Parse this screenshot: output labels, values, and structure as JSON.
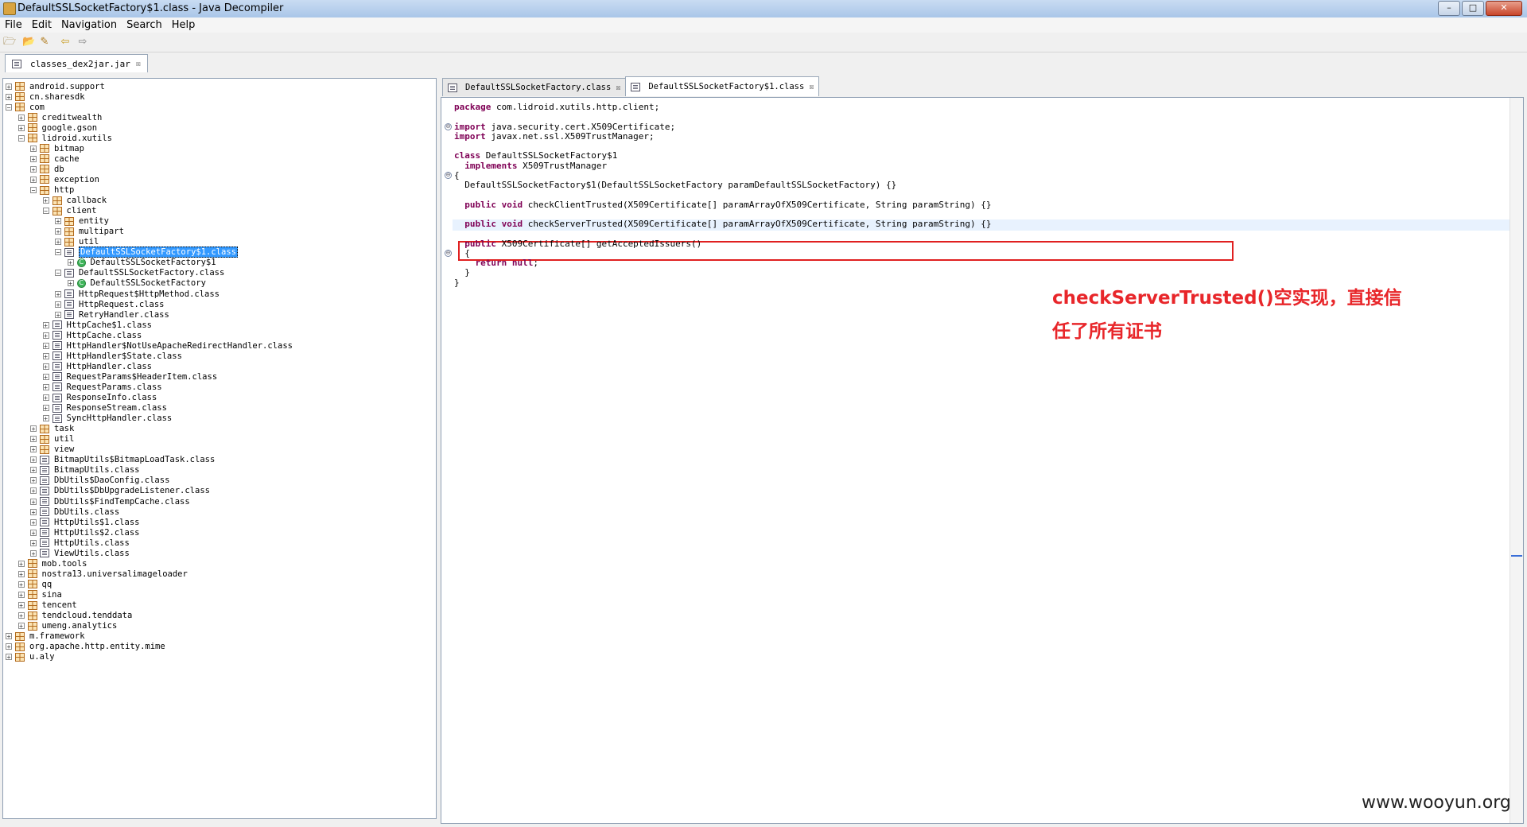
{
  "window": {
    "title": "DefaultSSLSocketFactory$1.class - Java Decompiler",
    "min_glyph": "–",
    "max_glyph": "□",
    "close_glyph": "✕"
  },
  "menu": [
    "File",
    "Edit",
    "Navigation",
    "Search",
    "Help"
  ],
  "toolbar": {
    "open_glyph": "🗁",
    "open_recent_glyph": "📂",
    "save_glyph": "✎",
    "back_glyph": "⇦",
    "forward_glyph": "⇨"
  },
  "left_tab": {
    "label": "classes_dex2jar.jar",
    "close_glyph": "☒"
  },
  "tree": [
    {
      "label": "android.support",
      "icon": "package",
      "expander": "+",
      "depth": 0
    },
    {
      "label": "cn.sharesdk",
      "icon": "package",
      "expander": "+",
      "depth": 0
    },
    {
      "label": "com",
      "icon": "package",
      "expander": "−",
      "depth": 0
    },
    {
      "label": "creditwealth",
      "icon": "package",
      "expander": "+",
      "depth": 1
    },
    {
      "label": "google.gson",
      "icon": "package",
      "expander": "+",
      "depth": 1
    },
    {
      "label": "lidroid.xutils",
      "icon": "package",
      "expander": "−",
      "depth": 1
    },
    {
      "label": "bitmap",
      "icon": "package",
      "expander": "+",
      "depth": 2
    },
    {
      "label": "cache",
      "icon": "package",
      "expander": "+",
      "depth": 2
    },
    {
      "label": "db",
      "icon": "package",
      "expander": "+",
      "depth": 2
    },
    {
      "label": "exception",
      "icon": "package",
      "expander": "+",
      "depth": 2
    },
    {
      "label": "http",
      "icon": "package",
      "expander": "−",
      "depth": 2
    },
    {
      "label": "callback",
      "icon": "package",
      "expander": "+",
      "depth": 3
    },
    {
      "label": "client",
      "icon": "package",
      "expander": "−",
      "depth": 3
    },
    {
      "label": "entity",
      "icon": "package",
      "expander": "+",
      "depth": 4
    },
    {
      "label": "multipart",
      "icon": "package",
      "expander": "+",
      "depth": 4
    },
    {
      "label": "util",
      "icon": "package",
      "expander": "+",
      "depth": 4
    },
    {
      "label": "DefaultSSLSocketFactory$1.class",
      "icon": "class",
      "expander": "−",
      "depth": 4,
      "selected": true
    },
    {
      "label": "DefaultSSLSocketFactory$1",
      "icon": "type",
      "expander": "+",
      "depth": 5
    },
    {
      "label": "DefaultSSLSocketFactory.class",
      "icon": "class",
      "expander": "−",
      "depth": 4
    },
    {
      "label": "DefaultSSLSocketFactory",
      "icon": "type",
      "expander": "+",
      "depth": 5
    },
    {
      "label": "HttpRequest$HttpMethod.class",
      "icon": "class",
      "expander": "+",
      "depth": 4
    },
    {
      "label": "HttpRequest.class",
      "icon": "class",
      "expander": "+",
      "depth": 4
    },
    {
      "label": "RetryHandler.class",
      "icon": "class",
      "expander": "+",
      "depth": 4
    },
    {
      "label": "HttpCache$1.class",
      "icon": "class",
      "expander": "+",
      "depth": 3
    },
    {
      "label": "HttpCache.class",
      "icon": "class",
      "expander": "+",
      "depth": 3
    },
    {
      "label": "HttpHandler$NotUseApacheRedirectHandler.class",
      "icon": "class",
      "expander": "+",
      "depth": 3
    },
    {
      "label": "HttpHandler$State.class",
      "icon": "class",
      "expander": "+",
      "depth": 3
    },
    {
      "label": "HttpHandler.class",
      "icon": "class",
      "expander": "+",
      "depth": 3
    },
    {
      "label": "RequestParams$HeaderItem.class",
      "icon": "class",
      "expander": "+",
      "depth": 3
    },
    {
      "label": "RequestParams.class",
      "icon": "class",
      "expander": "+",
      "depth": 3
    },
    {
      "label": "ResponseInfo.class",
      "icon": "class",
      "expander": "+",
      "depth": 3
    },
    {
      "label": "ResponseStream.class",
      "icon": "class",
      "expander": "+",
      "depth": 3
    },
    {
      "label": "SyncHttpHandler.class",
      "icon": "class",
      "expander": "+",
      "depth": 3
    },
    {
      "label": "task",
      "icon": "package",
      "expander": "+",
      "depth": 2
    },
    {
      "label": "util",
      "icon": "package",
      "expander": "+",
      "depth": 2
    },
    {
      "label": "view",
      "icon": "package",
      "expander": "+",
      "depth": 2
    },
    {
      "label": "BitmapUtils$BitmapLoadTask.class",
      "icon": "class",
      "expander": "+",
      "depth": 2
    },
    {
      "label": "BitmapUtils.class",
      "icon": "class",
      "expander": "+",
      "depth": 2
    },
    {
      "label": "DbUtils$DaoConfig.class",
      "icon": "class",
      "expander": "+",
      "depth": 2
    },
    {
      "label": "DbUtils$DbUpgradeListener.class",
      "icon": "class",
      "expander": "+",
      "depth": 2
    },
    {
      "label": "DbUtils$FindTempCache.class",
      "icon": "class",
      "expander": "+",
      "depth": 2
    },
    {
      "label": "DbUtils.class",
      "icon": "class",
      "expander": "+",
      "depth": 2
    },
    {
      "label": "HttpUtils$1.class",
      "icon": "class",
      "expander": "+",
      "depth": 2
    },
    {
      "label": "HttpUtils$2.class",
      "icon": "class",
      "expander": "+",
      "depth": 2
    },
    {
      "label": "HttpUtils.class",
      "icon": "class",
      "expander": "+",
      "depth": 2
    },
    {
      "label": "ViewUtils.class",
      "icon": "class",
      "expander": "+",
      "depth": 2
    },
    {
      "label": "mob.tools",
      "icon": "package",
      "expander": "+",
      "depth": 1
    },
    {
      "label": "nostra13.universalimageloader",
      "icon": "package",
      "expander": "+",
      "depth": 1
    },
    {
      "label": "qq",
      "icon": "package",
      "expander": "+",
      "depth": 1
    },
    {
      "label": "sina",
      "icon": "package",
      "expander": "+",
      "depth": 1
    },
    {
      "label": "tencent",
      "icon": "package",
      "expander": "+",
      "depth": 1
    },
    {
      "label": "tendcloud.tenddata",
      "icon": "package",
      "expander": "+",
      "depth": 1
    },
    {
      "label": "umeng.analytics",
      "icon": "package",
      "expander": "+",
      "depth": 1
    },
    {
      "label": "m.framework",
      "icon": "package",
      "expander": "+",
      "depth": 0
    },
    {
      "label": "org.apache.http.entity.mime",
      "icon": "package",
      "expander": "+",
      "depth": 0
    },
    {
      "label": "u.aly",
      "icon": "package",
      "expander": "+",
      "depth": 0
    }
  ],
  "editor_tabs": [
    {
      "label": "DefaultSSLSocketFactory.class",
      "active": false,
      "close_glyph": "☒"
    },
    {
      "label": "DefaultSSLSocketFactory$1.class",
      "active": true,
      "close_glyph": "☒"
    }
  ],
  "code": [
    {
      "tokens": [
        {
          "t": "package",
          "kw": true
        },
        {
          "t": " com.lidroid.xutils.http.client;"
        }
      ]
    },
    {
      "tokens": []
    },
    {
      "fold": "⊖",
      "tokens": [
        {
          "t": "import",
          "kw": true
        },
        {
          "t": " java.security.cert.X509Certificate;"
        }
      ]
    },
    {
      "tokens": [
        {
          "t": "import",
          "kw": true
        },
        {
          "t": " javax.net.ssl.X509TrustManager;"
        }
      ]
    },
    {
      "tokens": []
    },
    {
      "tokens": [
        {
          "t": "class",
          "kw": true
        },
        {
          "t": " DefaultSSLSocketFactory$1"
        }
      ]
    },
    {
      "tokens": [
        {
          "t": "  "
        },
        {
          "t": "implements",
          "kw": true
        },
        {
          "t": " X509TrustManager"
        }
      ]
    },
    {
      "fold": "⊖",
      "tokens": [
        {
          "t": "{"
        }
      ]
    },
    {
      "tokens": [
        {
          "t": "  DefaultSSLSocketFactory$1(DefaultSSLSocketFactory paramDefaultSSLSocketFactory) {}"
        }
      ]
    },
    {
      "tokens": []
    },
    {
      "tokens": [
        {
          "t": "  "
        },
        {
          "t": "public void",
          "kw": true
        },
        {
          "t": " checkClientTrusted(X509Certificate[] paramArrayOfX509Certificate, String paramString) {}"
        }
      ]
    },
    {
      "tokens": []
    },
    {
      "highlight": true,
      "tokens": [
        {
          "t": "  "
        },
        {
          "t": "public void",
          "kw": true
        },
        {
          "t": " checkServerTrusted(X509Certificate[] paramArrayOfX509Certificate, String paramString) {}"
        }
      ]
    },
    {
      "tokens": []
    },
    {
      "tokens": [
        {
          "t": "  "
        },
        {
          "t": "public",
          "kw": true
        },
        {
          "t": " X509Certificate[] getAcceptedIssuers()"
        }
      ]
    },
    {
      "fold": "⊖",
      "tokens": [
        {
          "t": "  {"
        }
      ]
    },
    {
      "tokens": [
        {
          "t": "    "
        },
        {
          "t": "return null",
          "kw": true
        },
        {
          "t": ";"
        }
      ]
    },
    {
      "tokens": [
        {
          "t": "  }"
        }
      ]
    },
    {
      "tokens": [
        {
          "t": "}"
        }
      ]
    }
  ],
  "annotation": {
    "line1": "checkServerTrusted()空实现，直接信",
    "line2": "任了所有证书"
  },
  "watermark": "www.wooyun.org"
}
